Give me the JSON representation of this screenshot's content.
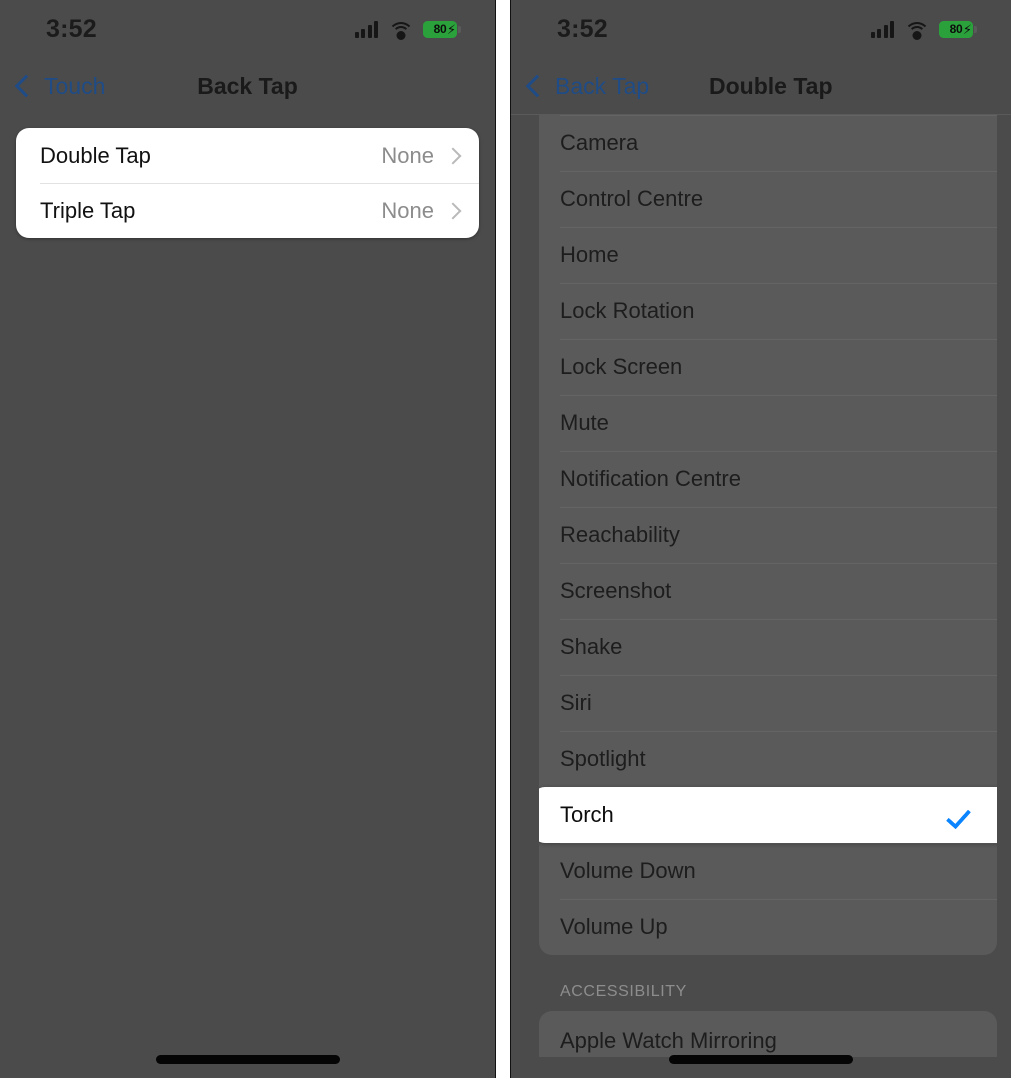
{
  "left_panel": {
    "status_bar": {
      "time": "3:52",
      "signal_icon": "cellular-signal-icon",
      "wifi_icon": "wifi-icon",
      "battery_percent": "80",
      "battery_charging_icon": "charging-bolt-icon"
    },
    "nav": {
      "back_label": "Touch",
      "back_icon": "chevron-left-icon",
      "title": "Back Tap"
    },
    "rows": [
      {
        "label": "Double Tap",
        "value": "None",
        "chevron": "chevron-right-icon"
      },
      {
        "label": "Triple Tap",
        "value": "None",
        "chevron": "chevron-right-icon"
      }
    ],
    "home_indicator": "home-indicator"
  },
  "right_panel": {
    "status_bar": {
      "time": "3:52",
      "signal_icon": "cellular-signal-icon",
      "wifi_icon": "wifi-icon",
      "battery_percent": "80",
      "battery_charging_icon": "charging-bolt-icon"
    },
    "nav": {
      "back_label": "Back Tap",
      "back_icon": "chevron-left-icon",
      "title": "Double Tap"
    },
    "options": [
      {
        "label": "Camera",
        "selected": false
      },
      {
        "label": "Control Centre",
        "selected": false
      },
      {
        "label": "Home",
        "selected": false
      },
      {
        "label": "Lock Rotation",
        "selected": false
      },
      {
        "label": "Lock Screen",
        "selected": false
      },
      {
        "label": "Mute",
        "selected": false
      },
      {
        "label": "Notification Centre",
        "selected": false
      },
      {
        "label": "Reachability",
        "selected": false
      },
      {
        "label": "Screenshot",
        "selected": false
      },
      {
        "label": "Shake",
        "selected": false
      },
      {
        "label": "Siri",
        "selected": false
      },
      {
        "label": "Spotlight",
        "selected": false
      },
      {
        "label": "Torch",
        "selected": true
      },
      {
        "label": "Volume Down",
        "selected": false
      },
      {
        "label": "Volume Up",
        "selected": false
      }
    ],
    "selected_checkmark_icon": "checkmark-icon",
    "section_header": "ACCESSIBILITY",
    "tail_rows": [
      {
        "label": "Apple Watch Mirroring"
      }
    ],
    "home_indicator": "home-indicator"
  },
  "colors": {
    "accent_blue": "#0a84ff",
    "link_blue": "#1f4c87",
    "battery_green": "#2aa13b",
    "dim_background": "#4b4b4b",
    "dim_card": "#5a5a5a",
    "highlight_card": "#ffffff"
  }
}
